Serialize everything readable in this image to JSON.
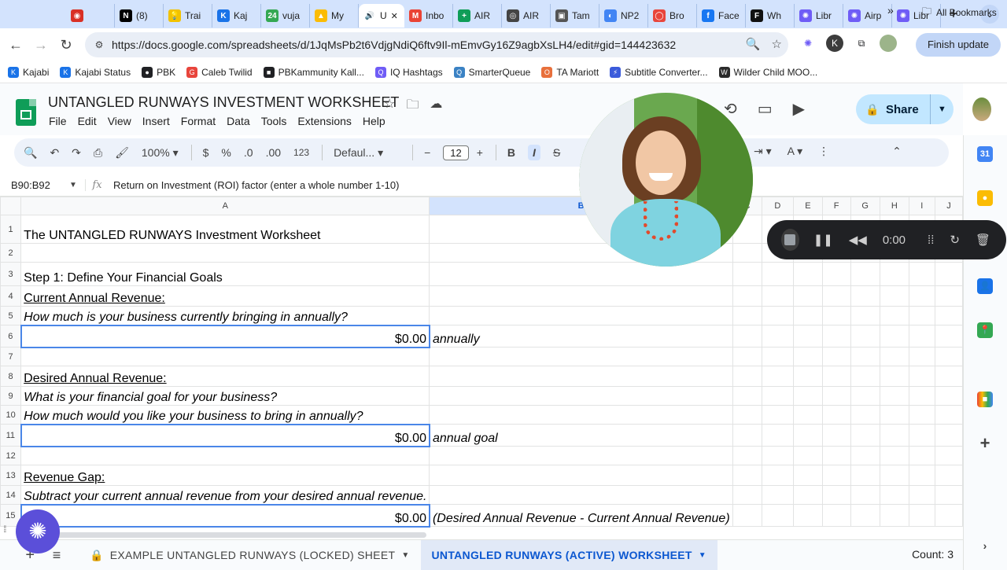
{
  "browser": {
    "tabs": [
      {
        "title": "",
        "color": "#d93025",
        "glyph": "◉"
      },
      {
        "title": "(8)",
        "color": "#000000",
        "glyph": "N"
      },
      {
        "title": "Trai",
        "color": "#f2c200",
        "glyph": "💡"
      },
      {
        "title": "Kaj",
        "color": "#1a73e8",
        "glyph": "K"
      },
      {
        "title": "vuja",
        "color": "#34a853",
        "glyph": "24"
      },
      {
        "title": "My",
        "color": "#fbbc04",
        "glyph": "▲"
      },
      {
        "title": "U",
        "color": "#ffffff",
        "glyph": "🔊",
        "active": true
      },
      {
        "title": "Inbo",
        "color": "#ea4335",
        "glyph": "M"
      },
      {
        "title": "AIR",
        "color": "#0f9d58",
        "glyph": "+"
      },
      {
        "title": "AIR",
        "color": "#444444",
        "glyph": "◎"
      },
      {
        "title": "Tam",
        "color": "#555555",
        "glyph": "▣"
      },
      {
        "title": "NP2",
        "color": "#4285f4",
        "glyph": "◐"
      },
      {
        "title": "Bro",
        "color": "#e8453c",
        "glyph": "◯"
      },
      {
        "title": "Face",
        "color": "#1877f2",
        "glyph": "f"
      },
      {
        "title": "Wh",
        "color": "#111111",
        "glyph": "F"
      },
      {
        "title": "Libr",
        "color": "#6f5cf6",
        "glyph": "✺"
      },
      {
        "title": "Airp",
        "color": "#6f5cf6",
        "glyph": "✺"
      },
      {
        "title": "Libr",
        "color": "#6f5cf6",
        "glyph": "✺"
      }
    ],
    "url": "https://docs.google.com/spreadsheets/d/1JqMsPb2t6VdjgNdiQ6ftv9Il-mEmvGy16Z9agbXsLH4/edit#gid=144423632",
    "finish_update": "Finish update",
    "bookmarks": [
      {
        "label": "Kajabi",
        "color": "#1a73e8",
        "glyph": "K"
      },
      {
        "label": "Kajabi Status",
        "color": "#1a73e8",
        "glyph": "K"
      },
      {
        "label": "PBK",
        "color": "#202124",
        "glyph": "●"
      },
      {
        "label": "Caleb Twilid",
        "color": "#e8453c",
        "glyph": "G"
      },
      {
        "label": "PBKammunity Kall...",
        "color": "#202124",
        "glyph": "■"
      },
      {
        "label": "IQ Hashtags",
        "color": "#6f5cf6",
        "glyph": "Q"
      },
      {
        "label": "SmarterQueue",
        "color": "#3b82c4",
        "glyph": "Q"
      },
      {
        "label": "TA Mariott",
        "color": "#e8703c",
        "glyph": "O"
      },
      {
        "label": "Subtitle Converter...",
        "color": "#3b5bdb",
        "glyph": "⚡"
      },
      {
        "label": "Wilder Child MOO...",
        "color": "#2b2b2b",
        "glyph": "W"
      }
    ],
    "all_bookmarks": "All Bookmarks"
  },
  "sheets": {
    "title": "UNTANGLED RUNWAYS INVESTMENT WORKSHEET",
    "menu": [
      "File",
      "Edit",
      "View",
      "Insert",
      "Format",
      "Data",
      "Tools",
      "Extensions",
      "Help"
    ],
    "share_label": "Share",
    "toolbar": {
      "zoom": "100%",
      "currency": "$",
      "percent": "%",
      "dec_decrease": ".0",
      "dec_increase": ".00",
      "number_format": "123",
      "font": "Defaul...",
      "font_size": "12",
      "bold": "B",
      "italic": "I",
      "strike": "S"
    },
    "name_box": "B90:B92",
    "formula_value": "Return on Investment (ROI) factor (enter a whole number 1-10)",
    "columns": [
      "A",
      "B",
      "C",
      "D",
      "E",
      "F",
      "G",
      "H",
      "I",
      "J"
    ],
    "rows": [
      {
        "n": "1",
        "a": "The UNTANGLED RUNWAYS Investment Worksheet",
        "style": "h1"
      },
      {
        "n": "2",
        "a": "",
        "style": ""
      },
      {
        "n": "3",
        "a": "Step 1: Define Your Financial Goals",
        "style": "h2"
      },
      {
        "n": "4",
        "a": "Current Annual Revenue:",
        "style": "h3"
      },
      {
        "n": "5",
        "a": "How much is your business currently bringing in annually?",
        "style": "ital"
      },
      {
        "n": "6",
        "a": "$0.00",
        "b": "annually",
        "style": "money"
      },
      {
        "n": "7",
        "a": "",
        "style": ""
      },
      {
        "n": "8",
        "a": "Desired Annual Revenue:",
        "style": "h3"
      },
      {
        "n": "9",
        "a": "What is your financial goal for your business?",
        "style": "ital"
      },
      {
        "n": "10",
        "a": "How much would you like your business to bring in annually?",
        "style": "ital"
      },
      {
        "n": "11",
        "a": "$0.00",
        "b": "annual goal",
        "style": "money"
      },
      {
        "n": "12",
        "a": "",
        "style": ""
      },
      {
        "n": "13",
        "a": "Revenue Gap:",
        "style": "h3"
      },
      {
        "n": "14",
        "a": "Subtract your current annual revenue from your desired annual revenue.",
        "style": "ital"
      },
      {
        "n": "15",
        "a": "$0.00",
        "b": "(Desired Annual Revenue - Current Annual Revenue)",
        "style": "money"
      }
    ],
    "sheet_tabs": [
      {
        "label": "EXAMPLE UNTANGLED RUNWAYS (LOCKED) SHEET",
        "locked": true,
        "active": false
      },
      {
        "label": "UNTANGLED RUNWAYS (ACTIVE) WORKSHEET",
        "locked": false,
        "active": true
      }
    ],
    "count": "Count: 3"
  },
  "recorder": {
    "time": "0:00"
  }
}
